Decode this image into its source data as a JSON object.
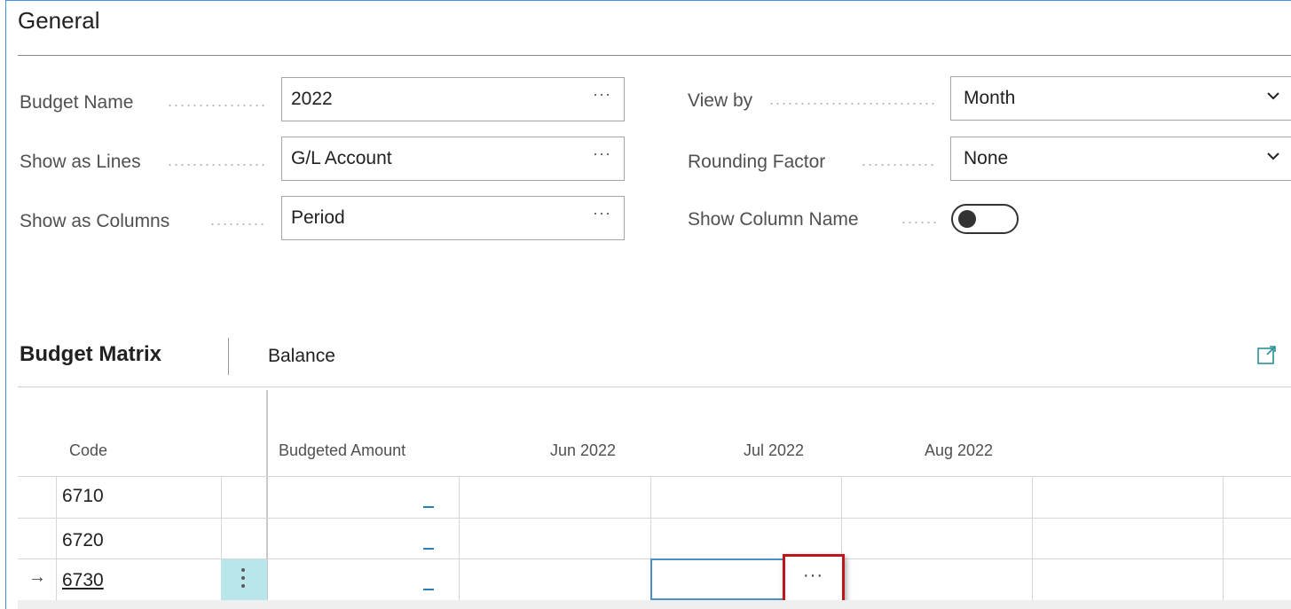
{
  "general": {
    "title": "General",
    "fields": {
      "budget_name": {
        "label": "Budget Name",
        "value": "2022",
        "action": "···"
      },
      "show_as_lines": {
        "label": "Show as Lines",
        "value": "G/L Account",
        "action": "···"
      },
      "show_as_columns": {
        "label": "Show as Columns",
        "value": "Period",
        "action": "···"
      },
      "view_by": {
        "label": "View by",
        "value": "Month"
      },
      "rounding_factor": {
        "label": "Rounding Factor",
        "value": "None"
      },
      "show_column_name": {
        "label": "Show Column Name",
        "value": false
      }
    }
  },
  "matrix": {
    "title": "Budget Matrix",
    "action": "Balance",
    "headers": {
      "code": "Code",
      "budgeted_amount": "Budgeted Amount",
      "jun": "Jun 2022",
      "jul": "Jul 2022",
      "aug": "Aug 2022"
    },
    "rows": [
      {
        "code": "6710",
        "budgeted_amount": "_"
      },
      {
        "code": "6720",
        "budgeted_amount": "_"
      },
      {
        "code": "6730",
        "budgeted_amount": "_",
        "selected": true
      }
    ],
    "row_indicator": "→",
    "cell_action": "···"
  },
  "icons": {
    "expand": "expand-icon",
    "dropdown": "chevron-down-icon",
    "row_menu": "kebab-menu-icon"
  },
  "colors": {
    "accent": "#2a7fb8",
    "selection": "#b9e6ea",
    "highlight": "#c0141c"
  }
}
